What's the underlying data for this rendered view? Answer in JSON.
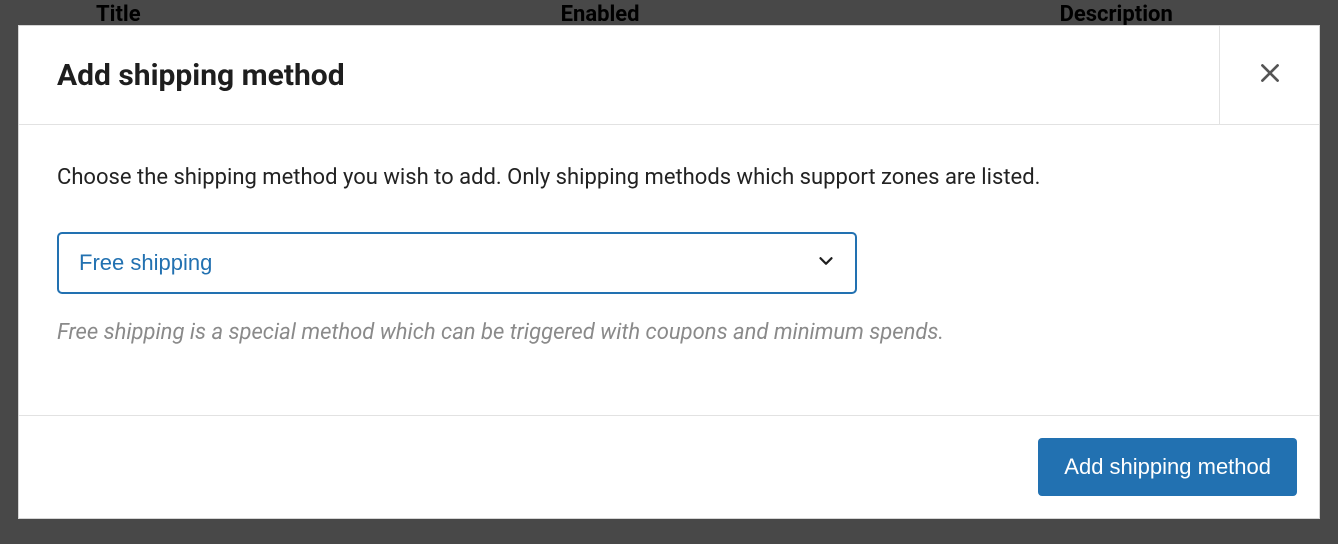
{
  "background": {
    "col1": "Title",
    "col2": "Enabled",
    "col3": "Description"
  },
  "modal": {
    "title": "Add shipping method",
    "body_text": "Choose the shipping method you wish to add. Only shipping methods which support zones are listed.",
    "select": {
      "selected_label": "Free shipping"
    },
    "description": "Free shipping is a special method which can be triggered with coupons and minimum spends.",
    "footer": {
      "submit_label": "Add shipping method"
    }
  }
}
